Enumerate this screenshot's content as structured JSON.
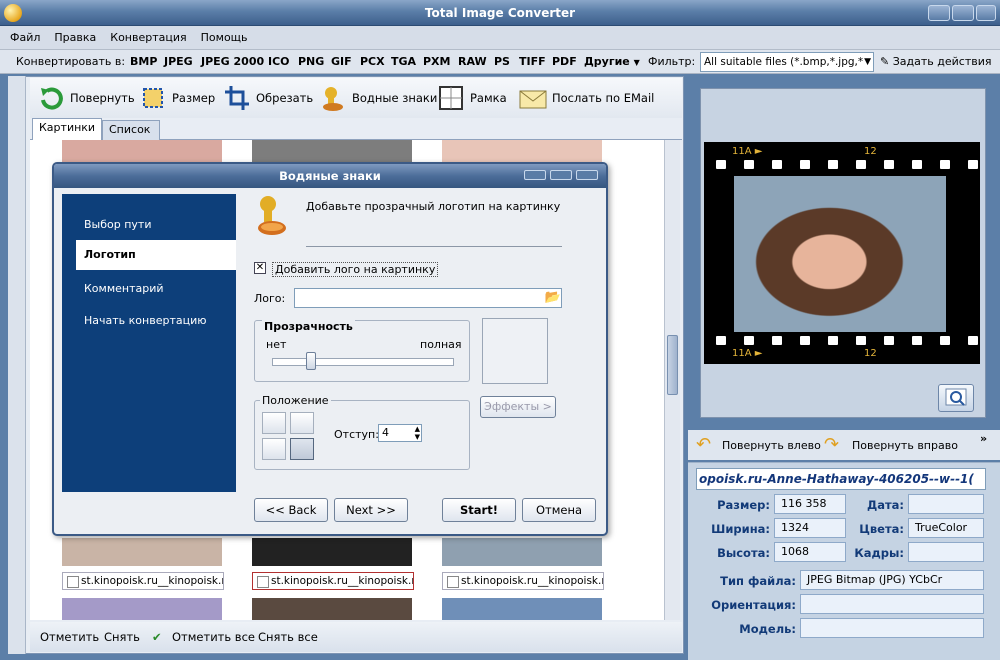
{
  "window": {
    "title": "Total Image Converter"
  },
  "menu": [
    "Файл",
    "Правка",
    "Конвертация",
    "Помощь"
  ],
  "formatbar": {
    "convert_label": "Конвертировать в:",
    "formats": [
      "BMP",
      "JPEG",
      "JPEG 2000",
      "ICO",
      "PNG",
      "GIF",
      "PCX",
      "TGA",
      "PXM",
      "RAW",
      "PS",
      "TIFF",
      "PDF"
    ],
    "other": "Другие",
    "filter_label": "Фильтр:",
    "filter_value": "All suitable files (*.bmp,*.jpg,*",
    "actions_label": "Задать действия"
  },
  "toolbar": {
    "rotate": "Повернуть",
    "resize": "Размер",
    "crop": "Обрезать",
    "watermark": "Водные знаки",
    "frame": "Рамка",
    "email": "Послать по EMail"
  },
  "tabs": [
    "Картинки",
    "Список"
  ],
  "thumbnails": {
    "captions": [
      "st.kinopoisk.ru__kinopoisk.ru",
      "st.kinopoisk.ru__kinopoisk.ru",
      "st.kinopoisk.ru__kinopoisk.ru"
    ]
  },
  "bottombar": {
    "mark": "Отметить",
    "unmark": "Снять",
    "mark_all": "Отметить все",
    "unmark_all": "Снять все"
  },
  "dialog": {
    "title": "Водяные знаки",
    "nav": [
      "Выбор пути",
      "Логотип",
      "Комментарий",
      "Начать конвертацию"
    ],
    "active_nav": 1,
    "header_text": "Добавьте прозрачный логотип на картинку",
    "add_logo_checkbox": "Добавить лого на картинку",
    "add_logo_checked": true,
    "logo_label": "Лого:",
    "logo_value": "",
    "transparency": {
      "title": "Прозрачность",
      "min_label": "нет",
      "max_label": "полная",
      "level": 0.2
    },
    "effects_button": "Эффекты >",
    "position": {
      "title": "Положение",
      "offset_label": "Отступ:",
      "offset_value": "4"
    },
    "buttons": {
      "back": "<< Back",
      "next": "Next >>",
      "start": "Start!",
      "cancel": "Отмена"
    }
  },
  "preview": {
    "film_labels_top": [
      "11A ►",
      "12"
    ],
    "film_labels_bottom": [
      "11A ►",
      "12"
    ]
  },
  "rotation": {
    "left": "Повернуть влево",
    "right": "Повернуть вправо"
  },
  "info": {
    "filename": "​opoisk.ru-Anne-Hathaway-406205--w--1(",
    "size_label": "Размер:",
    "size_value": "116 358",
    "date_label": "Дата:",
    "date_value": "",
    "width_label": "Ширина:",
    "width_value": "1324",
    "colors_label": "Цвета:",
    "colors_value": "TrueColor",
    "height_label": "Высота:",
    "height_value": "1068",
    "frames_label": "Кадры:",
    "frames_value": "",
    "filetype_label": "Тип файла:",
    "filetype_value": "JPEG Bitmap (JPG) YCbCr",
    "orientation_label": "Ориентация:",
    "orientation_value": "",
    "model_label": "Модель:",
    "model_value": ""
  },
  "colors": {
    "accent": "#0d3f7a",
    "title": "#3d5f8c"
  }
}
